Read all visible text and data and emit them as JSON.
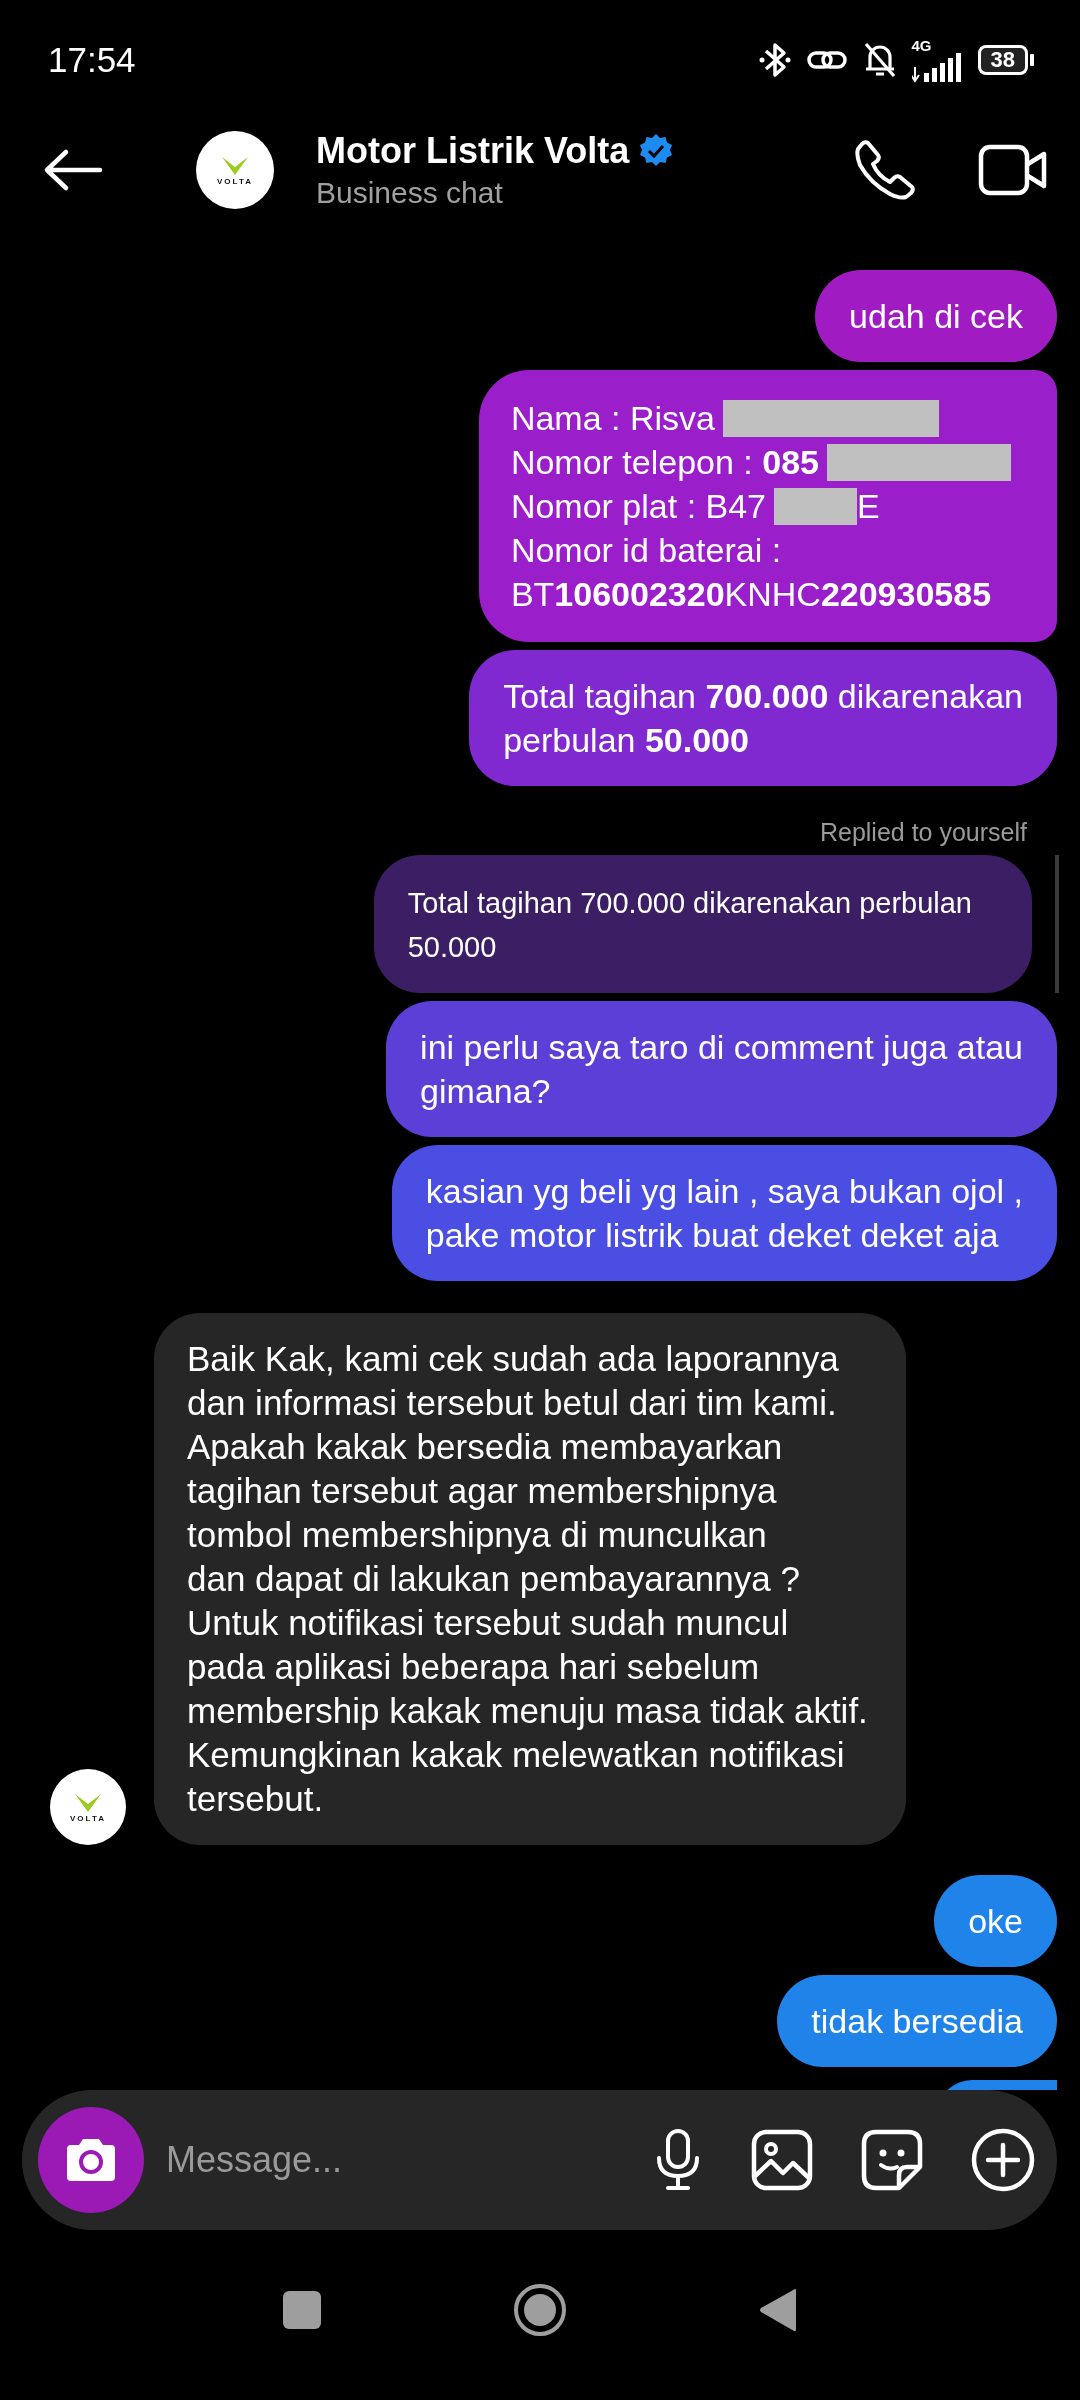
{
  "status_bar": {
    "time": "17:54",
    "network": "4G",
    "battery": "38"
  },
  "header": {
    "title": "Motor Listrik Volta",
    "verified": true,
    "subtitle": "Business chat",
    "avatar_text": "VOLTA"
  },
  "messages": [
    {
      "kind": "sent",
      "color": "#a11bc2",
      "lines": [
        "udah di cek"
      ]
    },
    {
      "kind": "details",
      "color": "#9a1ec9",
      "lines": [
        {
          "text": "Nama : Risva",
          "redacted": true
        },
        {
          "text": "Nomor telepon : **085**",
          "redacted": true
        },
        {
          "text": "Nomor plat : B47",
          "redacted": true,
          "after": "E"
        },
        {
          "text": "Nomor id baterai :",
          "redacted": false
        },
        {
          "text": "BT**106002320**KNHC**220930585**",
          "redacted": false
        }
      ]
    },
    {
      "kind": "sent",
      "color": "#8129d1",
      "lines": [
        "Total tagihan **700.000** dikarenakan",
        "perbulan **50.000**"
      ]
    },
    {
      "kind": "reply_label",
      "text": "Replied to yourself"
    },
    {
      "kind": "quote",
      "color": "#3b1e63",
      "lines": [
        "Total tagihan 700.000 dikarenakan perbulan",
        "50.000"
      ]
    },
    {
      "kind": "sent",
      "color": "#5b3fd6",
      "lines": [
        "ini perlu saya taro di comment juga atau",
        "gimana?"
      ]
    },
    {
      "kind": "sent",
      "color": "#4b4ee3",
      "lines": [
        "kasian yg beli yg lain , saya bukan ojol ,",
        "pake motor listrik buat deket deket aja"
      ]
    },
    {
      "kind": "received",
      "avatar_text": "VOLTA",
      "lines": [
        "Baik Kak, kami cek sudah ada laporannya",
        "dan informasi tersebut betul dari tim kami.",
        "Apakah kakak bersedia membayarkan",
        "tagihan tersebut agar membershipnya",
        "tombol membershipnya di munculkan",
        "dan dapat di lakukan pembayarannya ?",
        "Untuk notifikasi tersebut sudah muncul",
        "pada aplikasi beberapa hari sebelum",
        "membership kakak menuju masa tidak aktif.",
        "Kemungkinan kakak melewatkan notifikasi",
        "tersebut."
      ]
    },
    {
      "kind": "sent",
      "color": "#1f83ea",
      "lines": [
        "oke"
      ]
    },
    {
      "kind": "sent",
      "color": "#1f83ea",
      "lines": [
        "tidak bersedia"
      ]
    }
  ],
  "composer": {
    "placeholder": "Message..."
  }
}
